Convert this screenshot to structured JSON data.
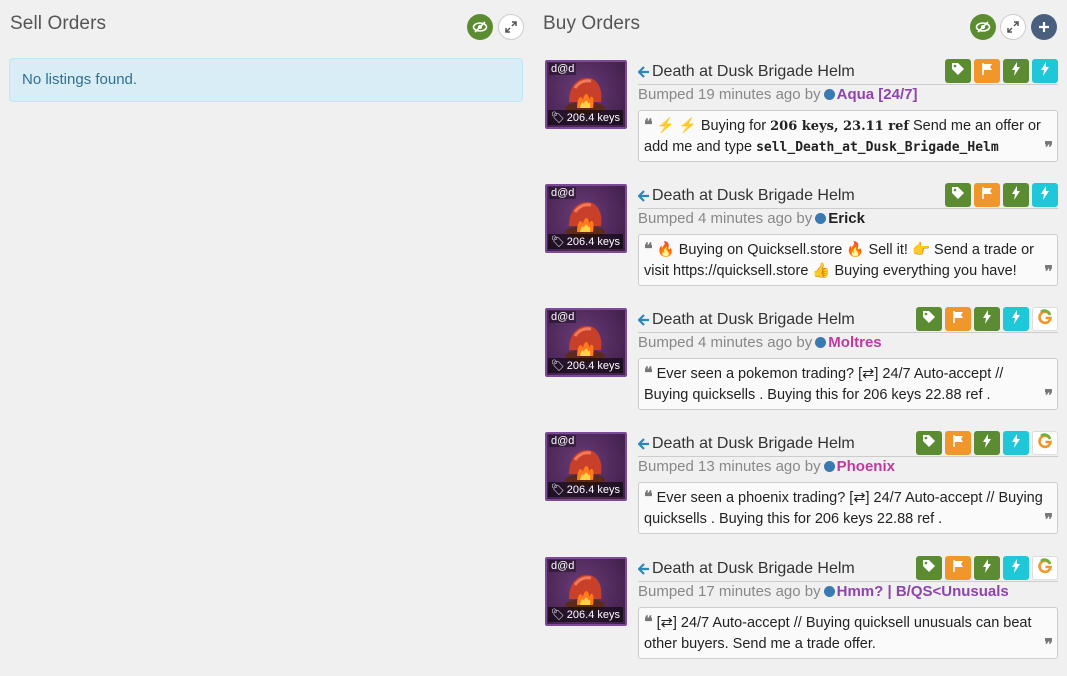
{
  "sell": {
    "title": "Sell Orders",
    "empty_text": "No listings found."
  },
  "buy": {
    "title": "Buy Orders"
  },
  "colors": {
    "green": "#5b8c32",
    "orange": "#f0962a",
    "teal": "#1ec8d8",
    "alert_bg": "#d9edf7",
    "alert_text": "#31708f"
  },
  "listings": [
    {
      "thumb_tag": "d@d",
      "price": "206.4 keys",
      "name": "Death at Dusk Brigade Helm",
      "bump_prefix": "Bumped 19 minutes ago by",
      "user": "Aqua [24/7]",
      "user_color": "#8e44ad",
      "badges": [
        "tag-icon",
        "flag-icon",
        "bolt-icon",
        "bolt-icon"
      ],
      "message": [
        "⚡ Buying for ",
        "206 keys, 23.11 ref",
        " Send me an offer or add me and type ",
        "sell_Death_at_Dusk_Brigade_Helm"
      ]
    },
    {
      "thumb_tag": "d@d",
      "price": "206.4 keys",
      "name": "Death at Dusk Brigade Helm",
      "bump_prefix": "Bumped 4 minutes ago by",
      "user": "Erick",
      "user_color": "#222222",
      "badges": [
        "tag-icon",
        "flag-icon",
        "bolt-icon",
        "bolt-icon"
      ],
      "message": "🔥 Buying on Quicksell.store 🔥  Sell it!  👉  Send a trade or visit https://quicksell.store  👍  Buying everything you have!"
    },
    {
      "thumb_tag": "d@d",
      "price": "206.4 keys",
      "name": "Death at Dusk Brigade Helm",
      "bump_prefix": "Bumped 4 minutes ago by",
      "user": "Moltres",
      "user_color": "#c0399f",
      "badges": [
        "tag-icon",
        "flag-icon",
        "bolt-icon",
        "bolt-icon",
        "g-icon"
      ],
      "message": "Ever seen a pokemon trading? [⇄] 24/7 Auto-accept // Buying quicksells . Buying this for 206 keys 22.88 ref ."
    },
    {
      "thumb_tag": "d@d",
      "price": "206.4 keys",
      "name": "Death at Dusk Brigade Helm",
      "bump_prefix": "Bumped 13 minutes ago by",
      "user": "Phoenix",
      "user_color": "#c0399f",
      "badges": [
        "tag-icon",
        "flag-icon",
        "bolt-icon",
        "bolt-icon",
        "g-icon"
      ],
      "message": "Ever seen a phoenix trading? [⇄] 24/7 Auto-accept // Buying quicksells . Buying this for 206 keys 22.88 ref ."
    },
    {
      "thumb_tag": "d@d",
      "price": "206.4 keys",
      "name": "Death at Dusk Brigade Helm",
      "bump_prefix": "Bumped 17 minutes ago by",
      "user": "Hmm? | B/QS<Unusuals",
      "user_color": "#8e44ad",
      "badges": [
        "tag-icon",
        "flag-icon",
        "bolt-icon",
        "bolt-icon",
        "g-icon"
      ],
      "message": "[⇄] 24/7 Auto-accept // Buying quicksell unusuals can beat other buyers. Send me a trade offer."
    }
  ]
}
